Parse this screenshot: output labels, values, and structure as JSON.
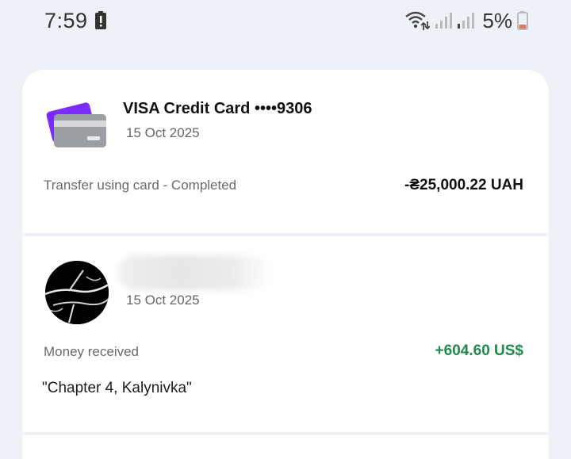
{
  "status_bar": {
    "time": "7:59",
    "alert_icon": "alert-icon",
    "wifi_icon": "wifi-icon",
    "signal_icons": [
      "signal-icon",
      "signal-icon"
    ],
    "battery_percent": "5%",
    "battery_icon": "battery-low-icon"
  },
  "transactions": [
    {
      "icon": "credit-card-icon",
      "title": "VISA Credit Card ••••9306",
      "date": "15 Oct 2025",
      "description": "Transfer using card - Completed",
      "amount": "-₴25,000.22 UAH",
      "amount_color": "#111111"
    },
    {
      "icon": "avatar",
      "title": "",
      "date": "15 Oct 2025",
      "description": "Money received",
      "amount": "+604.60 US$",
      "amount_color": "#1f8a4c",
      "comment": "\"Chapter 4, Kalynivka\""
    }
  ]
}
